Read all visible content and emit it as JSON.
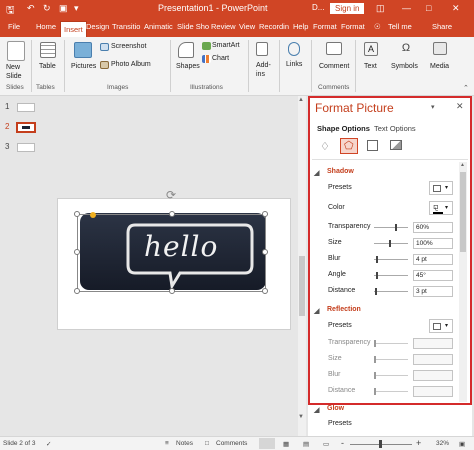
{
  "window": {
    "title": "Presentation1  -  PowerPoint",
    "account_initial": "D...",
    "sign_in": "Sign in"
  },
  "tabs": [
    "File",
    "Home",
    "Insert",
    "Design",
    "Transitio",
    "Animatic",
    "Slide Sho",
    "Review",
    "View",
    "Recordin",
    "Help",
    "Format",
    "Format",
    "Tell me",
    "Share"
  ],
  "ribbon": {
    "new_slide": "New\nSlide",
    "slides_group": "Slides",
    "table": "Table",
    "tables_group": "Tables",
    "pictures": "Pictures",
    "screenshot": "Screenshot",
    "photo_album": "Photo Album",
    "images_group": "Images",
    "shapes": "Shapes",
    "smartart": "SmartArt",
    "chart": "Chart",
    "illustrations_group": "Illustrations",
    "addins": "Add-\nins",
    "links": "Links",
    "comment": "Comment",
    "comments_group": "Comments",
    "text": "Text",
    "symbols": "Symbols",
    "media": "Media"
  },
  "thumbnails": [
    {
      "num": "1"
    },
    {
      "num": "2",
      "selected": true
    },
    {
      "num": "3"
    }
  ],
  "slide": {
    "image_text": "hello"
  },
  "format_pane": {
    "title": "Format Picture",
    "tab_shape": "Shape Options",
    "tab_text": "Text Options",
    "shadow": {
      "header": "Shadow",
      "presets": "Presets",
      "color": "Color",
      "transparency": "Transparency",
      "transparency_val": "60%",
      "size": "Size",
      "size_val": "100%",
      "blur": "Blur",
      "blur_val": "4 pt",
      "angle": "Angle",
      "angle_val": "45°",
      "distance": "Distance",
      "distance_val": "3 pt"
    },
    "reflection": {
      "header": "Reflection",
      "presets": "Presets",
      "transparency": "Transparency",
      "size": "Size",
      "blur": "Blur",
      "distance": "Distance"
    },
    "glow": {
      "header": "Glow",
      "presets": "Presets"
    }
  },
  "status": {
    "slide_info": "Slide 2 of 3",
    "notes": "Notes",
    "comments": "Comments",
    "zoom": "32%"
  },
  "colors": {
    "accent": "#d04525",
    "pane_border": "#d42b2b"
  }
}
